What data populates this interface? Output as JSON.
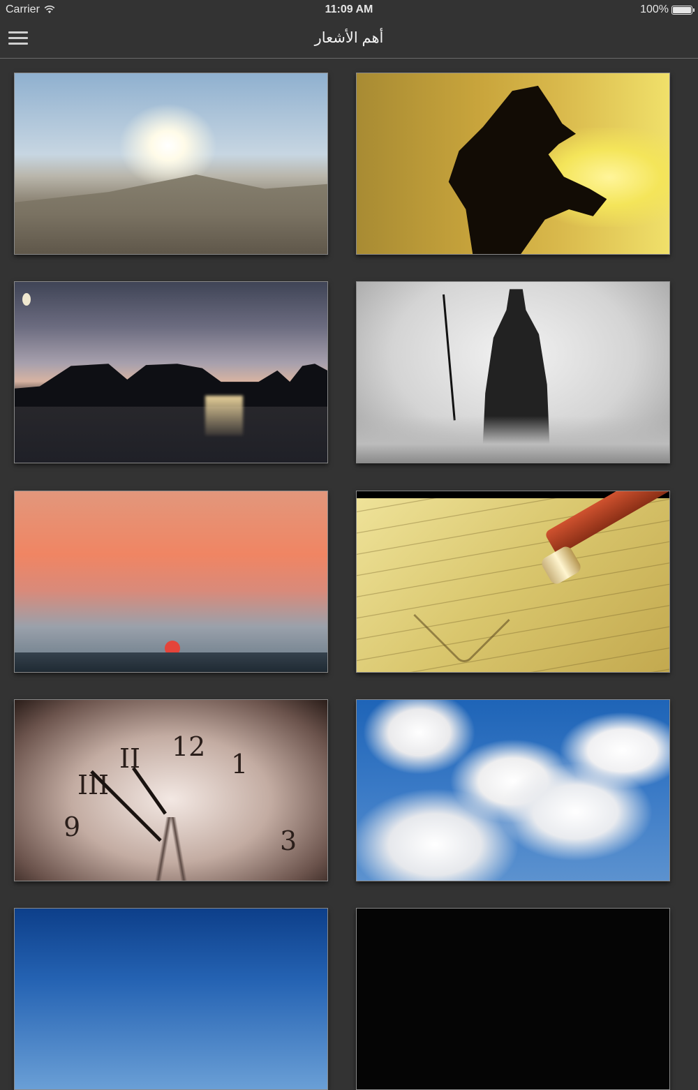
{
  "status_bar": {
    "carrier": "Carrier",
    "time": "11:09 AM",
    "battery": "100%",
    "battery_level": 1.0
  },
  "nav": {
    "title": "أهم الأشعار",
    "menu_icon": "hamburger-menu-icon"
  },
  "grid": {
    "items": [
      {
        "name": "desert-sun-image"
      },
      {
        "name": "black-horse-image"
      },
      {
        "name": "lake-dusk-image"
      },
      {
        "name": "knight-sword-image"
      },
      {
        "name": "sea-sunset-image"
      },
      {
        "name": "pencil-heart-image"
      },
      {
        "name": "clock-rails-image"
      },
      {
        "name": "blue-sky-clouds-image"
      },
      {
        "name": "blue-sky-image"
      },
      {
        "name": "dark-image"
      }
    ]
  },
  "colors": {
    "background": "#333333",
    "nav_divider": "#6a6a6a",
    "text": "#f2f2f2"
  }
}
